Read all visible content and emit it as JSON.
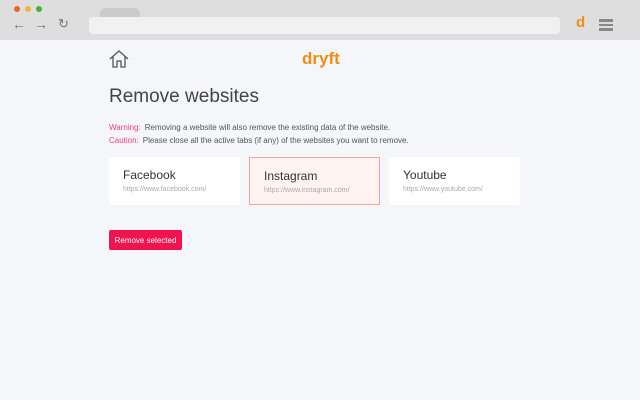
{
  "browser": {
    "extension_icon": "d"
  },
  "header": {
    "logo": "dryft"
  },
  "page": {
    "title": "Remove websites",
    "warning_label": "Warning:",
    "warning_text": "Removing a website will also remove the existing data of the website.",
    "caution_label": "Caution:",
    "caution_text": "Please close all the active tabs (if any) of the websites you want to remove."
  },
  "websites": [
    {
      "name": "Facebook",
      "url": "https://www.facebook.com/",
      "selected": false
    },
    {
      "name": "Instagram",
      "url": "https://www.instagram.com/",
      "selected": true
    },
    {
      "name": "Youtube",
      "url": "https://www.youtube.com/",
      "selected": false
    }
  ],
  "actions": {
    "remove_label": "Remove selected"
  }
}
